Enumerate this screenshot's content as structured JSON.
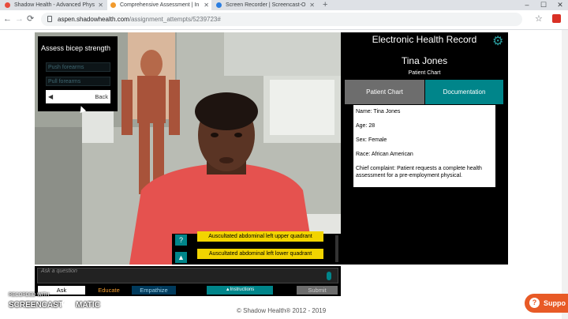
{
  "browser": {
    "tabs": [
      {
        "title": "Shadow Health - Advanced Phys",
        "active": false,
        "favicon_color": "#e84c3d"
      },
      {
        "title": "Comprehensive Assessment | In",
        "active": true,
        "favicon_color": "#f29b2e"
      },
      {
        "title": "Screen Recorder | Screencast-O",
        "active": false,
        "favicon_color": "#2a7de1"
      }
    ],
    "new_tab": "+",
    "window_controls": [
      "–",
      "☐",
      "✕"
    ],
    "nav": {
      "back": "←",
      "forward": "→",
      "reload": "⟳"
    },
    "url_host": "aspen.shadowhealth.com",
    "url_path": "/assignment_attempts/5239723#",
    "star": "☆"
  },
  "menu": {
    "title": "Assess bicep strength",
    "options": [
      "Push forearms",
      "Pull forearms"
    ],
    "back_label": "Back",
    "back_arrow": "◀"
  },
  "ehr": {
    "title": "Electronic Health Record",
    "gear": "⚙",
    "patient_name": "Tina Jones",
    "patient_sub": "Patient Chart",
    "tab_chart": "Patient Chart",
    "tab_doc": "Documentation",
    "info": [
      "Name: Tina Jones",
      "Age: 28",
      "Sex: Female",
      "Race: African American",
      "Chief complaint: Patient requests a complete health assessment for a pre-employment physical."
    ]
  },
  "chat": {
    "help_icon": "?",
    "up_icon": "▲",
    "items": [
      "Auscultated abdominal left upper quadrant",
      "Auscultated abdominal left lower quadrant"
    ],
    "input_placeholder": "Ask a question"
  },
  "modes": {
    "ask": "Ask",
    "educate": "Educate",
    "empathize": "Empathize",
    "instructions": "▲Instructions",
    "submit": "Submit"
  },
  "footer": {
    "copyright": "© Shadow Health® 2012 - 2019"
  },
  "watermark": {
    "recorded_with": "RECORDED WITH",
    "brand_left": "SCREENCAST",
    "brand_right": "MATIC"
  },
  "support": {
    "label": "Suppo",
    "icon": "?"
  }
}
